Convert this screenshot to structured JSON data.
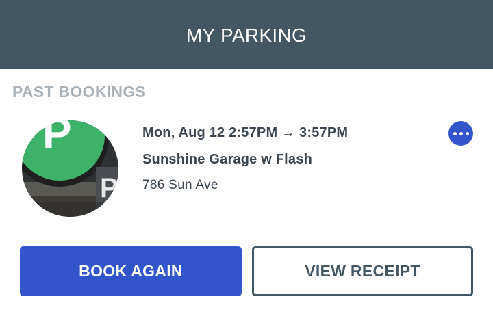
{
  "header": {
    "title": "MY PARKING"
  },
  "section": {
    "label": "PAST BOOKINGS"
  },
  "booking": {
    "time_range": "Mon, Aug 12 2:57PM → 3:57PM",
    "garage_name": "Sunshine Garage w Flash",
    "address": "786 Sun Ave",
    "thumbnail_icon": "parking-sign-photo"
  },
  "actions": {
    "book_again_label": "BOOK AGAIN",
    "view_receipt_label": "VIEW RECEIPT"
  },
  "colors": {
    "header_bg": "#435663",
    "accent": "#3355cc",
    "section_label": "#a9b1b8",
    "text": "#3b4650"
  }
}
